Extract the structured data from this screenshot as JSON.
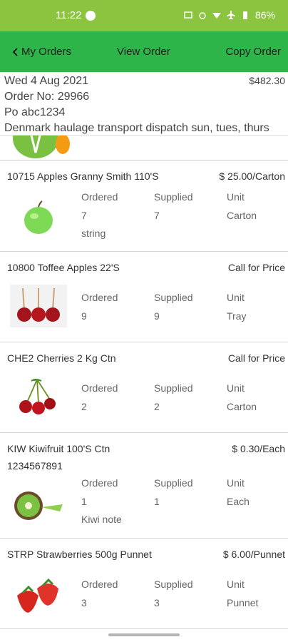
{
  "status_bar": {
    "time": "11:22",
    "battery": "86%"
  },
  "app_bar": {
    "back_label": "My Orders",
    "title": "View Order",
    "copy_label": "Copy Order"
  },
  "order": {
    "date": "Wed 4 Aug 2021",
    "amount": "$482.30",
    "order_no": "Order No: 29966",
    "po": "Po abc1234",
    "note": "Denmark haulage transport dispatch sun, tues, thurs"
  },
  "labels": {
    "ordered": "Ordered",
    "supplied": "Supplied",
    "unit": "Unit"
  },
  "items": [
    {
      "name": "10715 Apples Granny Smith 110'S",
      "price": "$ 25.00/Carton",
      "ordered": "7",
      "supplied": "7",
      "unit": "Carton",
      "note": "string",
      "icon": "green-apple-icon"
    },
    {
      "name": "10800 Toffee Apples 22'S",
      "price": "Call for Price",
      "ordered": "9",
      "supplied": "9",
      "unit": "Tray",
      "note": "",
      "icon": "toffee-apples-icon"
    },
    {
      "name": "CHE2 Cherries 2 Kg Ctn",
      "price": "Call for Price",
      "ordered": "2",
      "supplied": "2",
      "unit": "Carton",
      "note": "",
      "icon": "cherries-icon"
    },
    {
      "name": "KIW Kiwifruit 100'S Ctn",
      "code2": "1234567891",
      "price": "$ 0.30/Each",
      "ordered": "1",
      "supplied": "1",
      "unit": "Each",
      "note": "Kiwi note",
      "icon": "kiwifruit-icon"
    },
    {
      "name": "STRP Strawberries 500g Punnet",
      "price": "$ 6.00/Punnet",
      "ordered": "3",
      "supplied": "3",
      "unit": "Punnet",
      "note": "",
      "icon": "strawberry-icon"
    }
  ],
  "colors": {
    "status_bar": "#8bc53f",
    "app_bar": "#2db54a"
  }
}
